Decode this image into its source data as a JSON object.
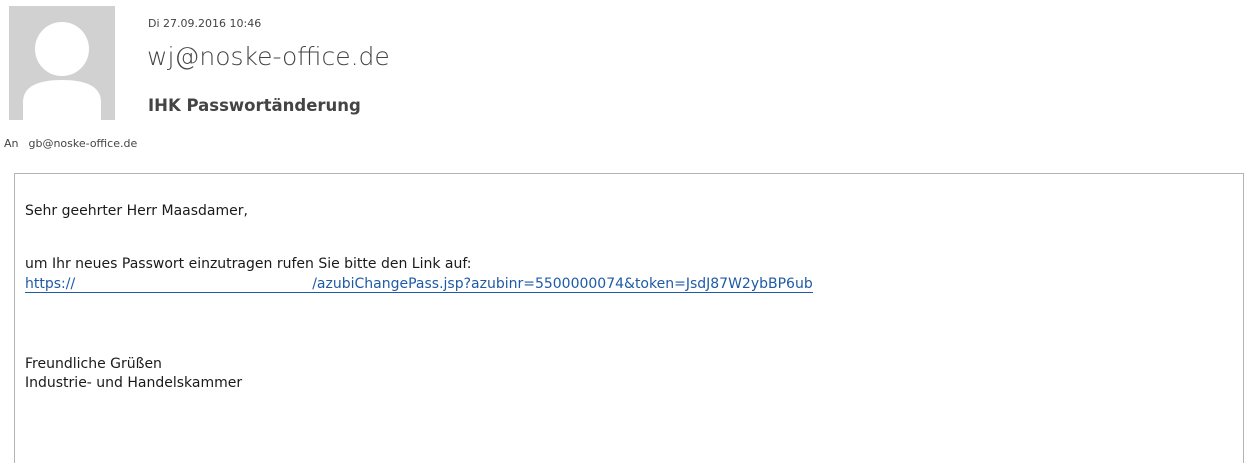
{
  "header": {
    "date": "Di 27.09.2016 10:46",
    "sender": "wj@noske-office.de",
    "subject": "IHK Passwortänderung",
    "to_label": "An",
    "to_address": "gb@noske-office.de"
  },
  "avatar": {
    "icon": "person-silhouette-icon",
    "background": "#d1d1d1"
  },
  "body": {
    "greeting": "Sehr geehrter Herr Maasdamer,",
    "instruction": "um Ihr neues Passwort einzutragen rufen Sie bitte den Link auf:",
    "link_prefix": "https://",
    "link_suffix": "/azubiChangePass.jsp?azubinr=5500000074&token=JsdJ87W2ybBP6ub",
    "closing": "Freundliche Grüßen",
    "signature": "Industrie- und Handelskammer"
  },
  "colors": {
    "link": "#1f5aa6",
    "border": "#b4b4b4"
  }
}
